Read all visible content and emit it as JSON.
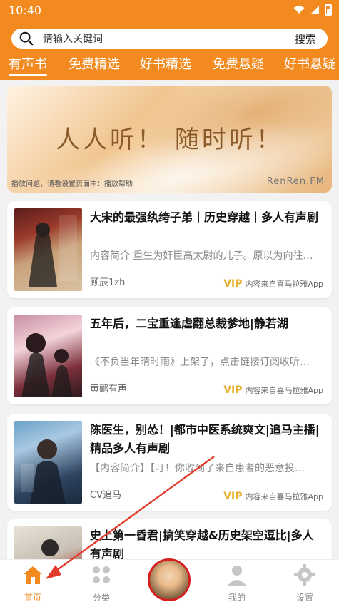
{
  "status": {
    "time": "10:40"
  },
  "search": {
    "placeholder": "请输入关键词",
    "button": "搜索"
  },
  "tabs": [
    {
      "label": "有声书",
      "active": true
    },
    {
      "label": "免费精选"
    },
    {
      "label": "好书精选"
    },
    {
      "label": "免费悬疑"
    },
    {
      "label": "好书悬疑"
    }
  ],
  "banner": {
    "title": "人人听！ 随时听！",
    "note": "播放问题，请看设置页面中：播放帮助",
    "brand": "RenRen.FM"
  },
  "books": [
    {
      "title": "大宋的最强纨绔子弟丨历史穿越丨多人有声剧",
      "desc": "内容简介 重生为奸臣高太尉的儿子。原以为向往…",
      "author": "顾辰1zh",
      "vip": "VIP",
      "source": "内容来自喜马拉雅App"
    },
    {
      "title": "五年后，二宝重逢虐翻总裁爹地|静若湖",
      "desc": "《不负当年晴时雨》上架了，点击链接订阅收听…",
      "author": "黄鹂有声",
      "vip": "VIP",
      "source": "内容来自喜马拉雅App"
    },
    {
      "title": "陈医生，别怂！|都市中医系统爽文|追马主播|精品多人有声剧",
      "desc": "【内容简介】【叮！你收到了来自患者的恶意投…",
      "author": "CV追马",
      "vip": "VIP",
      "source": "内容来自喜马拉雅App"
    },
    {
      "title": "史上第一昏君|搞笑穿越&历史架空逗比|多人有声剧",
      "desc": "",
      "author": "",
      "vip": "",
      "source": ""
    }
  ],
  "bottom_nav": [
    {
      "label": "首页",
      "icon": "home-icon",
      "active": true
    },
    {
      "label": "分类",
      "icon": "grid-icon"
    },
    {
      "label": "",
      "icon": "avatar-icon"
    },
    {
      "label": "我的",
      "icon": "user-icon"
    },
    {
      "label": "设置",
      "icon": "gear-icon"
    }
  ],
  "colors": {
    "brand": "#f28a1f",
    "vip": "#e7b22d",
    "annotation": "#e23b2b"
  }
}
